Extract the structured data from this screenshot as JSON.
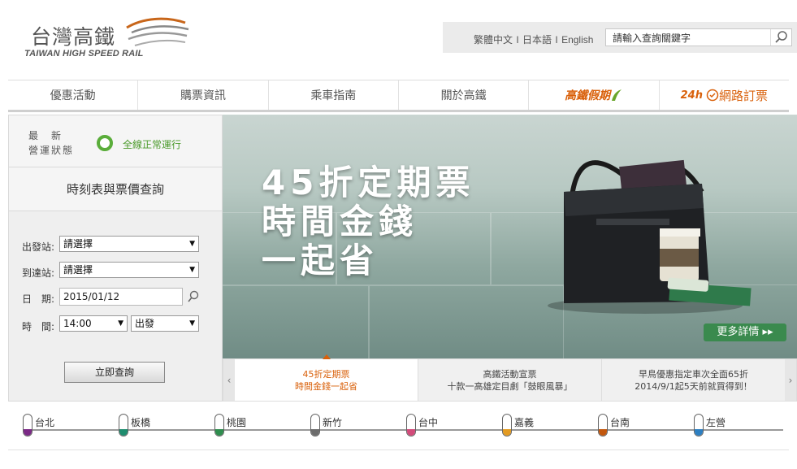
{
  "header": {
    "logo_cn": "台灣高鐵",
    "logo_en": "TAIWAN HIGH SPEED RAIL",
    "languages": [
      "繁體中文",
      "日本語",
      "English"
    ],
    "search_placeholder": "請輸入查詢關鍵字"
  },
  "nav": {
    "items": [
      "優惠活動",
      "購票資訊",
      "乘車指南",
      "關於高鐵"
    ],
    "holiday": "高鐵假期",
    "order_prefix": "24h",
    "order": "網路訂票"
  },
  "status": {
    "label": "最　新 營運狀態",
    "text": "全線正常運行"
  },
  "query": {
    "title": "時刻表與票價查詢",
    "from_label": "出發站:",
    "from_value": "請選擇",
    "to_label": "到達站:",
    "to_value": "請選擇",
    "date_label": "日　期:",
    "date_value": "2015/01/12",
    "time_label": "時　間:",
    "time_value": "14:00",
    "direction_value": "出發",
    "submit": "立即查詢"
  },
  "hero": {
    "line1": "45折定期票",
    "line2": "時間金錢",
    "line3": "一起省",
    "more": "更多詳情 ▸▸"
  },
  "promos": [
    {
      "l1": "45折定期票",
      "l2": "時間金錢一起省"
    },
    {
      "l1": "高鐵活動宣票",
      "l2": "十款一高雄定目劇「鼓眼風暴」"
    },
    {
      "l1": "早鳥優惠指定車次全面65折",
      "l2": "2014/9/1起5天前就買得到！"
    }
  ],
  "stations": [
    {
      "name": "台北",
      "color": "#7b2a86"
    },
    {
      "name": "板橋",
      "color": "#1e8c6e"
    },
    {
      "name": "桃園",
      "color": "#2f8d4e"
    },
    {
      "name": "新竹",
      "color": "#6c6c6c"
    },
    {
      "name": "台中",
      "color": "#d24b7a"
    },
    {
      "name": "嘉義",
      "color": "#e39b22"
    },
    {
      "name": "台南",
      "color": "#c2570e"
    },
    {
      "name": "左營",
      "color": "#2d7fc1"
    }
  ]
}
